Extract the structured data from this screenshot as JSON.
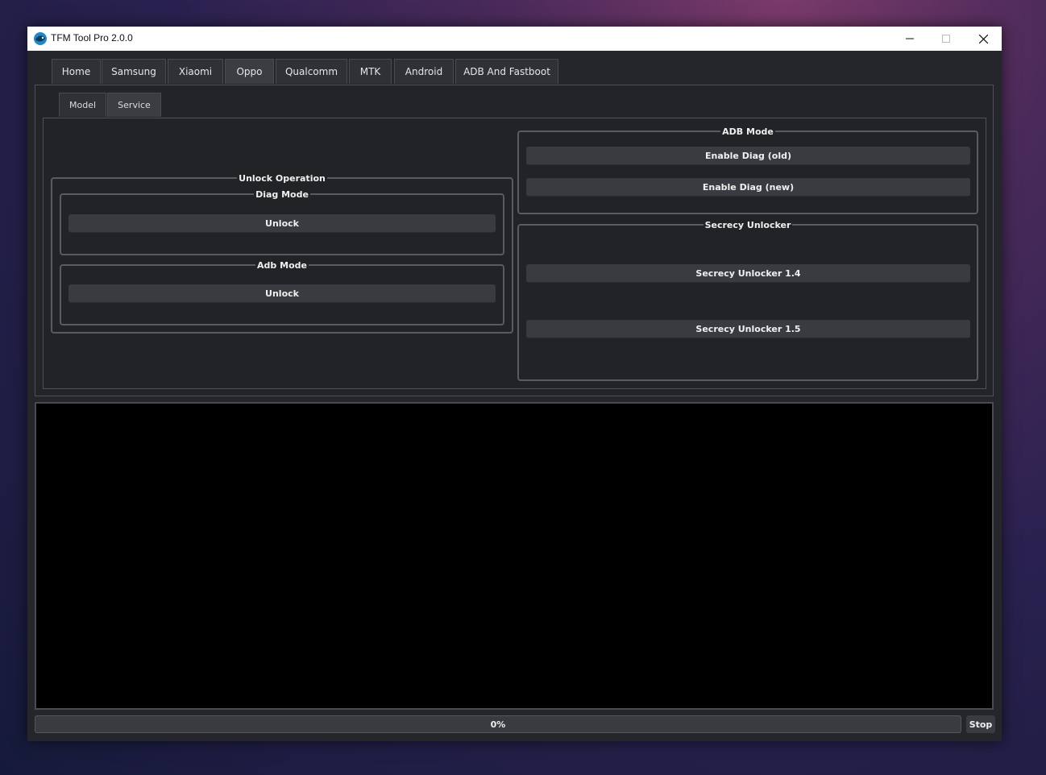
{
  "window": {
    "title": "TFM Tool Pro 2.0.0",
    "icon": "fish-logo-icon"
  },
  "main_tabs": [
    {
      "label": "Home",
      "active": false
    },
    {
      "label": "Samsung",
      "active": false
    },
    {
      "label": "Xiaomi",
      "active": false
    },
    {
      "label": "Oppo",
      "active": true
    },
    {
      "label": "Qualcomm",
      "active": false
    },
    {
      "label": "MTK",
      "active": false
    },
    {
      "label": "Android",
      "active": false
    },
    {
      "label": "ADB And Fastboot",
      "active": false
    }
  ],
  "sub_tabs": [
    {
      "label": "Model",
      "active": false
    },
    {
      "label": "Service",
      "active": true
    }
  ],
  "unlock_operation": {
    "title": "Unlock Operation",
    "diag_mode": {
      "title": "Diag Mode",
      "button": "Unlock"
    },
    "adb_mode": {
      "title": "Adb Mode",
      "button": "Unlock"
    }
  },
  "adb_mode_group": {
    "title": "ADB Mode",
    "buttons": [
      "Enable Diag (old)",
      "Enable Diag (new)"
    ]
  },
  "secrecy_unlocker": {
    "title": "Secrecy Unlocker",
    "buttons": [
      "Secrecy Unlocker 1.4",
      "Secrecy Unlocker 1.5"
    ]
  },
  "progress": {
    "label": "0%",
    "value": 0
  },
  "stop_label": "Stop",
  "colors": {
    "accent": "#3a3b40",
    "panel": "#25262b",
    "log": "#000000"
  }
}
